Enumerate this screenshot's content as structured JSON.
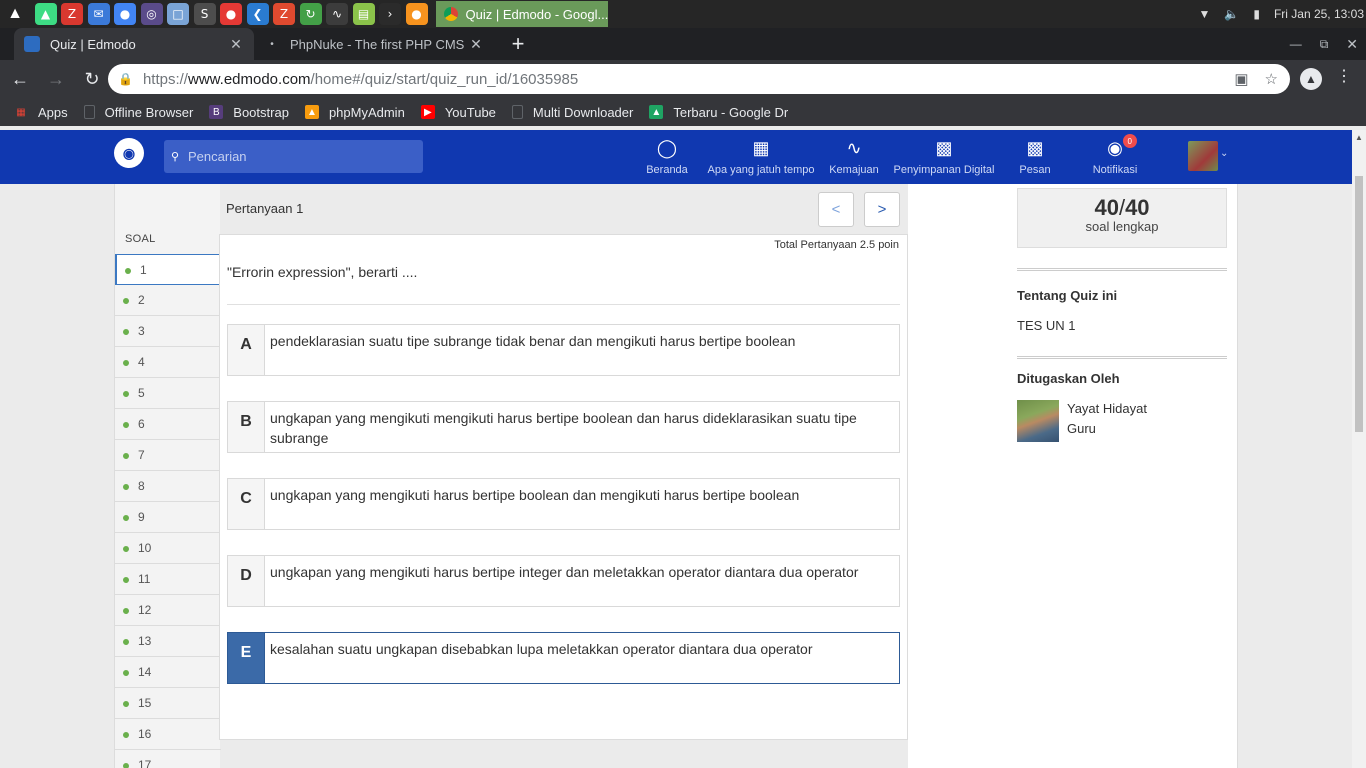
{
  "os": {
    "launcher_icon": "linux-tux-icon",
    "apps": [
      {
        "icon": "android-studio-icon",
        "color": "#3ddc84"
      },
      {
        "icon": "filezilla-icon",
        "color": "#d9382f"
      },
      {
        "icon": "bluemail-icon",
        "color": "#3b7ad9"
      },
      {
        "icon": "chrome-icon",
        "color": "#4285f4"
      },
      {
        "icon": "obs-icon",
        "color": "#5a4b8a"
      },
      {
        "icon": "virtualbox-icon",
        "color": "#7aa4d6"
      },
      {
        "icon": "sublime-text-icon",
        "color": "#4d4d4d"
      },
      {
        "icon": "recorder-icon",
        "color": "#e53935"
      },
      {
        "icon": "vscode-icon",
        "color": "#2a7bd0"
      },
      {
        "icon": "zeal-icon",
        "color": "#e04a2f"
      },
      {
        "icon": "update-icon",
        "color": "#43a047"
      },
      {
        "icon": "system-monitor-icon",
        "color": "#3c3c3c"
      },
      {
        "icon": "files-icon",
        "color": "#8bc34a"
      },
      {
        "icon": "terminal-icon",
        "color": "#2b2b2b"
      },
      {
        "icon": "firefox-dev-icon",
        "color": "#f7931e"
      }
    ],
    "active_window": "Quiz | Edmodo - Googl...",
    "clock": "Fri Jan 25, 13:03"
  },
  "browser": {
    "tabs": [
      {
        "title": "Quiz | Edmodo",
        "active": true
      },
      {
        "title": "PhpNuke - The first PHP CMS - F",
        "active": false
      }
    ],
    "url": {
      "scheme": "https://",
      "host": "www.edmodo.com",
      "path": "/home#/quiz/start/quiz_run_id/16035985"
    },
    "bookmarks": [
      {
        "label": "Apps",
        "icon": "apps-grid-icon"
      },
      {
        "label": "Offline Browser",
        "icon": "page-icon"
      },
      {
        "label": "Bootstrap",
        "icon": "bootstrap-icon"
      },
      {
        "label": "phpMyAdmin",
        "icon": "phpmyadmin-icon"
      },
      {
        "label": "YouTube",
        "icon": "youtube-icon"
      },
      {
        "label": "Multi Downloader",
        "icon": "page-icon"
      },
      {
        "label": "Terbaru - Google Dr",
        "icon": "google-drive-icon"
      }
    ]
  },
  "edmodo": {
    "search_placeholder": "Pencarian",
    "nav": [
      {
        "label": "Beranda",
        "icon": "home-icon"
      },
      {
        "label": "Apa yang jatuh tempo",
        "icon": "calendar-check-icon"
      },
      {
        "label": "Kemajuan",
        "icon": "progress-pulse-icon"
      },
      {
        "label": "Penyimpanan Digital",
        "icon": "backpack-icon"
      },
      {
        "label": "Pesan",
        "icon": "message-icon"
      },
      {
        "label": "Notifikasi",
        "icon": "bell-icon"
      }
    ],
    "notification_count": "0"
  },
  "quiz": {
    "question_title": "Pertanyaan 1",
    "prev_label": "<",
    "next_label": ">",
    "soal_label": "SOAL",
    "question_numbers": [
      "1",
      "2",
      "3",
      "4",
      "5",
      "6",
      "7",
      "8",
      "9",
      "10",
      "11",
      "12",
      "13",
      "14",
      "15",
      "16",
      "17"
    ],
    "current_question": "1",
    "points": "Total Pertanyaan 2.5 poin",
    "question_text": "\"Errorin expression\", berarti ....",
    "answers": [
      {
        "letter": "A",
        "text": "pendeklarasian suatu tipe subrange tidak benar dan mengikuti harus bertipe boolean",
        "selected": false
      },
      {
        "letter": "B",
        "text": "ungkapan yang mengikuti mengikuti harus bertipe boolean dan harus dideklarasikan suatu tipe subrange",
        "selected": false
      },
      {
        "letter": "C",
        "text": "ungkapan yang mengikuti harus bertipe boolean dan mengikuti harus bertipe boolean",
        "selected": false
      },
      {
        "letter": "D",
        "text": "ungkapan yang mengikuti harus bertipe integer dan meletakkan operator diantara dua operator",
        "selected": false
      },
      {
        "letter": "E",
        "text": "kesalahan suatu ungkapan disebabkan lupa meletakkan operator diantara dua operator",
        "selected": true
      }
    ]
  },
  "sidebar": {
    "answered": "40",
    "total": "40",
    "progress_caption": "soal lengkap",
    "about_heading": "Tentang Quiz ini",
    "quiz_name": "TES UN 1",
    "assigned_heading": "Ditugaskan Oleh",
    "teacher_name": "Yayat Hidayat",
    "teacher_role": "Guru"
  }
}
